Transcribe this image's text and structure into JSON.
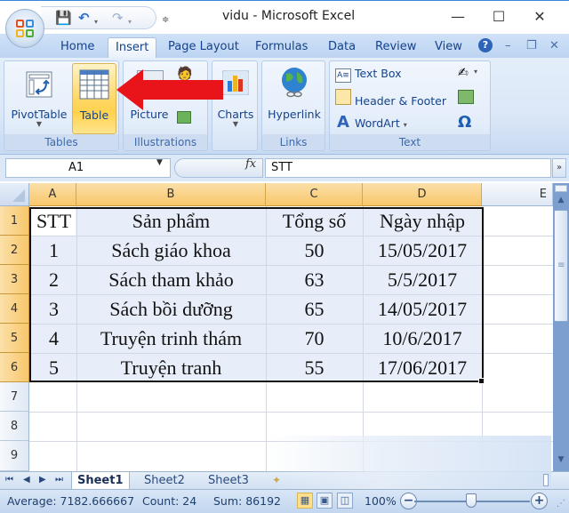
{
  "window": {
    "title": "vidu - Microsoft Excel",
    "controls": {
      "minimize": "—",
      "maximize": "☐",
      "close": "✕"
    }
  },
  "quick_access": {
    "save_icon": "save-icon",
    "undo_icon": "undo-icon",
    "redo_icon": "redo-icon",
    "customize_icon": "customize-icon"
  },
  "ribbon_tabs": [
    {
      "label": "Home",
      "active": false
    },
    {
      "label": "Insert",
      "active": true
    },
    {
      "label": "Page Layout",
      "active": false
    },
    {
      "label": "Formulas",
      "active": false
    },
    {
      "label": "Data",
      "active": false
    },
    {
      "label": "Review",
      "active": false
    },
    {
      "label": "View",
      "active": false
    }
  ],
  "ribbon_right": {
    "help": "?",
    "minimize": "–",
    "restore": "❐",
    "close": "✕"
  },
  "ribbon": {
    "groups": {
      "tables": {
        "label": "Tables",
        "pivottable": "PivotTable",
        "table": "Table"
      },
      "illustrations": {
        "label": "Illustrations",
        "picture": "Picture"
      },
      "charts": {
        "label": "Charts"
      },
      "links": {
        "label": "Links",
        "hyperlink": "Hyperlink"
      },
      "text": {
        "label": "Text",
        "textbox": "Text Box",
        "header_footer": "Header & Footer",
        "wordart": "WordArt",
        "wordart_caret": "▾",
        "symbol": "Ω"
      }
    }
  },
  "annotation": {
    "arrow_color": "#e8141a",
    "points_to": "Table"
  },
  "formula_bar": {
    "name_box": "A1",
    "fx": "fx",
    "formula": "STT"
  },
  "sheet": {
    "columns": [
      "A",
      "B",
      "C",
      "D",
      "E"
    ],
    "rows": [
      "1",
      "2",
      "3",
      "4",
      "5",
      "6",
      "7",
      "8",
      "9"
    ],
    "header": [
      "STT",
      "Sản phẩm",
      "Tổng số",
      "Ngày nhập"
    ],
    "data": [
      [
        "1",
        "Sách giáo khoa",
        "50",
        "15/05/2017"
      ],
      [
        "2",
        "Sách tham khảo",
        "63",
        "5/5/2017"
      ],
      [
        "3",
        "Sách bồi dưỡng",
        "65",
        "14/05/2017"
      ],
      [
        "4",
        "Truyện trinh thám",
        "70",
        "10/6/2017"
      ],
      [
        "5",
        "Truyện tranh",
        "55",
        "17/06/2017"
      ]
    ],
    "active_cell": "A1",
    "selected_range": "A1:D6"
  },
  "sheet_tabs": [
    {
      "label": "Sheet1",
      "active": true
    },
    {
      "label": "Sheet2",
      "active": false
    },
    {
      "label": "Sheet3",
      "active": false
    }
  ],
  "status_bar": {
    "average": "Average: 7182.666667",
    "count": "Count: 24",
    "sum": "Sum: 86192",
    "zoom": "100%",
    "zoom_level_percent": 100
  },
  "colors": {
    "ribbon_blue": "#dbe7f7",
    "tab_text": "#15428b",
    "selected_header": "#f8c76b",
    "selection_fill": "#e8eef9"
  }
}
